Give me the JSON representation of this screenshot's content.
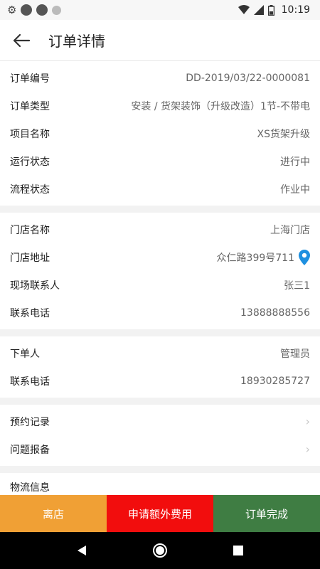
{
  "status_bar": {
    "time": "10:19",
    "icons": [
      "gear-icon",
      "notification-dot-icon",
      "notification-dot-icon",
      "notification-dot-icon",
      "wifi-icon",
      "signal-icon",
      "battery-icon"
    ]
  },
  "header": {
    "title": "订单详情",
    "back_icon": "arrow-left-icon"
  },
  "order_info": [
    {
      "label": "订单编号",
      "value": "DD-2019/03/22-0000081"
    },
    {
      "label": "订单类型",
      "value": "安装 / 货架装饰（升级改造）1节-不带电"
    },
    {
      "label": "项目名称",
      "value": "XS货架升级"
    },
    {
      "label": "运行状态",
      "value": "进行中"
    },
    {
      "label": "流程状态",
      "value": "作业中"
    }
  ],
  "store_info": [
    {
      "label": "门店名称",
      "value": "上海门店"
    },
    {
      "label": "门店地址",
      "value": "众仁路399号711"
    },
    {
      "label": "现场联系人",
      "value": "张三1"
    },
    {
      "label": "联系电话",
      "value": "13888888556"
    }
  ],
  "orderer_info": [
    {
      "label": "下单人",
      "value": "管理员"
    },
    {
      "label": "联系电话",
      "value": "18930285727"
    }
  ],
  "links": [
    {
      "label": "预约记录"
    },
    {
      "label": "问题报备"
    }
  ],
  "logistics": {
    "label": "物流信息"
  },
  "actions": [
    {
      "label": "离店",
      "color": "#f0a035"
    },
    {
      "label": "申请额外费用",
      "color": "#f20d0d"
    },
    {
      "label": "订单完成",
      "color": "#3f7d43"
    }
  ],
  "colors": {
    "pin": "#1e90e0"
  }
}
